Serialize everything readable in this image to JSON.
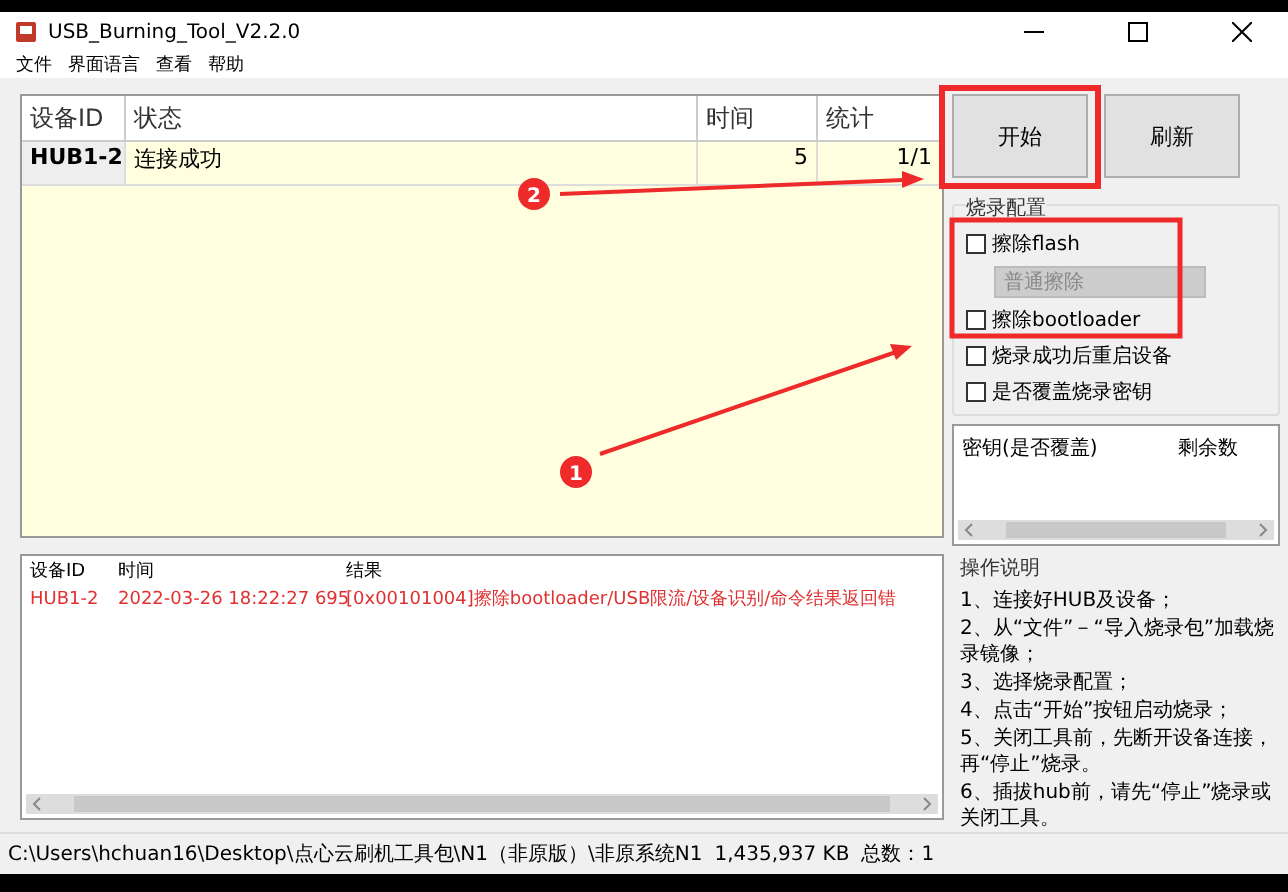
{
  "window": {
    "title": "USB_Burning_Tool_V2.2.0"
  },
  "menu": [
    "文件",
    "界面语言",
    "查看",
    "帮助"
  ],
  "device_table": {
    "columns": [
      "设备ID",
      "状态",
      "时间",
      "统计"
    ],
    "rows": [
      {
        "device_id": "HUB1-2",
        "status": "连接成功",
        "time": "5",
        "count": "1/1"
      }
    ]
  },
  "buttons": [
    "开始",
    "刷新"
  ],
  "burn_config": {
    "title": "烧录配置",
    "options": [
      {
        "kind": "checkbox",
        "label": "擦除flash",
        "checked": false
      },
      {
        "kind": "select",
        "value": "普通擦除",
        "disabled": true
      },
      {
        "kind": "checkbox",
        "label": "擦除bootloader",
        "checked": false
      },
      {
        "kind": "checkbox",
        "label": "烧录成功后重启设备",
        "checked": false
      },
      {
        "kind": "checkbox",
        "label": "是否覆盖烧录密钥",
        "checked": false
      }
    ]
  },
  "key_list": {
    "columns": [
      "密钥(是否覆盖)",
      "剩余数"
    ]
  },
  "instructions": {
    "title": "操作说明",
    "lines": [
      "1、连接好HUB及设备；",
      "2、从“文件”－“导入烧录包”加载烧录镜像；",
      "3、选择烧录配置；",
      "4、点击“开始”按钮启动烧录；",
      "5、关闭工具前，先断开设备连接，再“停止”烧录。",
      "6、插拔hub前，请先“停止”烧录或关闭工具。"
    ]
  },
  "log": {
    "columns": [
      "设备ID",
      "时间",
      "结果"
    ],
    "rows": [
      {
        "device_id": "HUB1-2",
        "time": "2022-03-26 18:22:27 695",
        "result": "[0x00101004]擦除bootloader/USB限流/设备识别/命令结果返回错"
      }
    ]
  },
  "status_bar": {
    "path": "C:\\Users\\hchuan16\\Desktop\\点心云刷机工具包\\N1（非原版）\\非原系统N1",
    "size": "1,435,937 KB",
    "total": "总数：1"
  },
  "annotations": [
    {
      "number": "1"
    },
    {
      "number": "2"
    }
  ]
}
